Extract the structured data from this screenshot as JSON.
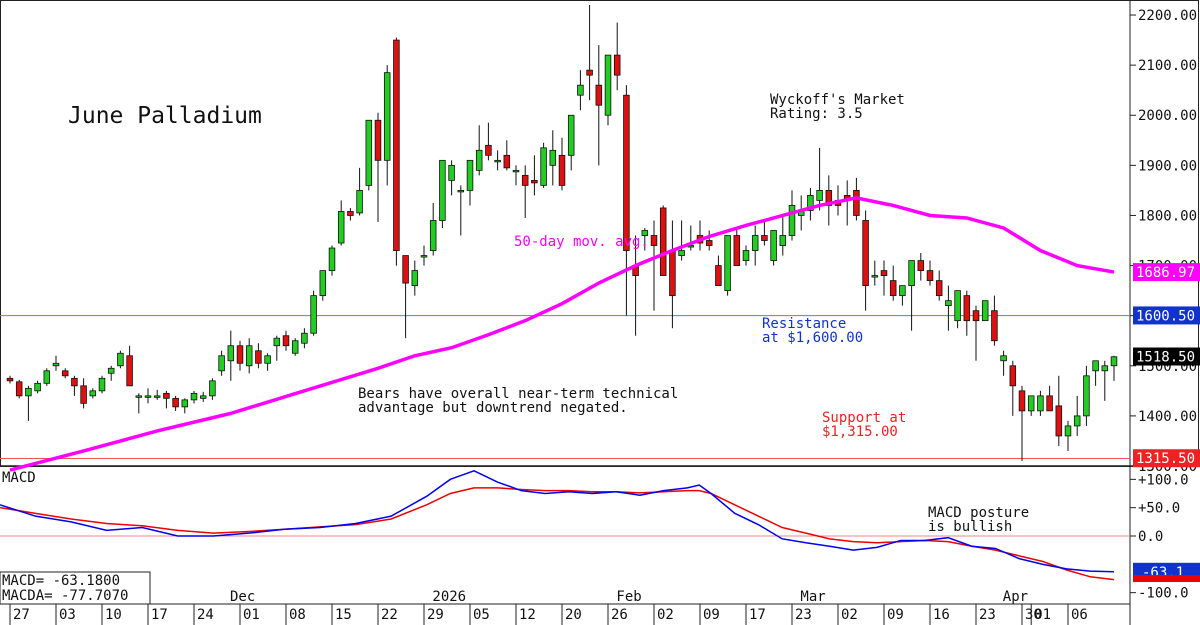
{
  "chart_data": {
    "type": "candlestick",
    "title": "June Palladium",
    "rating": "Wyckoff's Market\nRating: 3.5",
    "colors": {
      "up": "#22cc22",
      "down": "#dd1111",
      "ma": "#ff00ff",
      "macd": "#0000ee",
      "signal": "#ee0000",
      "resistance": "#6677dd",
      "support": "#ee5555"
    },
    "price_axis": {
      "ylim": [
        1300,
        2230
      ],
      "ticks": [
        1300,
        1400,
        1500,
        1600,
        1700,
        1800,
        1900,
        2000,
        2100,
        2200
      ],
      "tick_labels": [
        "1300.00",
        "1400.00",
        "1500.00",
        "1600.00",
        "1700.00",
        "1800.00",
        "1900.00",
        "2000.00",
        "2100.00",
        "2200.00"
      ]
    },
    "price_labels": [
      {
        "text": "1686.97",
        "value": 1686.97,
        "bg": "#ff00ff",
        "fg": "#ffffff"
      },
      {
        "text": "1600.50",
        "value": 1600.5,
        "bg": "#1133cc",
        "fg": "#ffffff"
      },
      {
        "text": "1518.50",
        "value": 1518.5,
        "bg": "#000000",
        "fg": "#ffffff"
      },
      {
        "text": "1315.50",
        "value": 1315.5,
        "bg": "#ee2222",
        "fg": "#ffffff"
      }
    ],
    "resistance": 1600,
    "support": 1315,
    "annotations": [
      {
        "id": "ma",
        "text": "50-day mov. avg.",
        "color": "#ff00ff"
      },
      {
        "id": "resistance",
        "text": "Resistance\nat $1,600.00",
        "color": "#1133cc"
      },
      {
        "id": "support",
        "text": "Support at\n$1,315.00",
        "color": "#ee2222"
      },
      {
        "id": "bears",
        "text": "Bears have overall near-term technical\nadvantage but downtrend negated.",
        "color": "#111111"
      },
      {
        "id": "macd_posture",
        "text": "MACD posture\nis bullish",
        "color": "#111111"
      }
    ],
    "macd_axis": {
      "ylim": [
        -120,
        120
      ],
      "ticks": [
        100,
        50,
        0,
        -100
      ],
      "tick_labels": [
        "+100.0",
        "+50.0",
        "0.0",
        "-100.0"
      ]
    },
    "macd_title": "MACD",
    "macd_readout": [
      "MACD=   -63.1800",
      "MACDA=  -77.7070"
    ],
    "macd_value_label": {
      "text": "-63.1",
      "value": -63.18,
      "bg": "#1133cc",
      "fg": "#ffffff"
    },
    "macd_signal_value": -77.707,
    "x_labels": [
      "27",
      "03",
      "10",
      "17",
      "24",
      "01",
      "08",
      "15",
      "22",
      "29",
      "05",
      "12",
      "20",
      "26",
      "02",
      "09",
      "17",
      "23",
      "02",
      "09",
      "16",
      "23",
      "30",
      "01",
      "06"
    ],
    "x_label_index": [
      0,
      5,
      10,
      15,
      20,
      25,
      30,
      35,
      40,
      45,
      50,
      55,
      60,
      65,
      70,
      75,
      80,
      85,
      90,
      95,
      100,
      105,
      110,
      111,
      115
    ],
    "month_labels": [
      {
        "text": "Dec",
        "index": 25
      },
      {
        "text": "2026",
        "index": 47
      },
      {
        "text": "Feb",
        "index": 67
      },
      {
        "text": "Mar",
        "index": 87
      },
      {
        "text": "Apr",
        "index": 109
      }
    ],
    "bars": [
      [
        1475,
        1480,
        1465,
        1470
      ],
      [
        1468,
        1472,
        1435,
        1440
      ],
      [
        1440,
        1460,
        1390,
        1455
      ],
      [
        1450,
        1470,
        1445,
        1465
      ],
      [
        1465,
        1495,
        1460,
        1490
      ],
      [
        1500,
        1520,
        1490,
        1505
      ],
      [
        1490,
        1495,
        1475,
        1480
      ],
      [
        1475,
        1480,
        1440,
        1460
      ],
      [
        1460,
        1475,
        1415,
        1425
      ],
      [
        1440,
        1455,
        1435,
        1450
      ],
      [
        1450,
        1480,
        1445,
        1475
      ],
      [
        1485,
        1500,
        1470,
        1495
      ],
      [
        1500,
        1530,
        1495,
        1525
      ],
      [
        1520,
        1540,
        1460,
        1460
      ],
      [
        1440,
        1445,
        1405,
        1440
      ],
      [
        1440,
        1455,
        1425,
        1440
      ],
      [
        1440,
        1452,
        1432,
        1440
      ],
      [
        1445,
        1450,
        1415,
        1435
      ],
      [
        1435,
        1440,
        1410,
        1418
      ],
      [
        1418,
        1435,
        1405,
        1432
      ],
      [
        1432,
        1450,
        1425,
        1445
      ],
      [
        1435,
        1448,
        1428,
        1440
      ],
      [
        1440,
        1475,
        1432,
        1470
      ],
      [
        1490,
        1530,
        1480,
        1520
      ],
      [
        1510,
        1570,
        1470,
        1540
      ],
      [
        1540,
        1550,
        1490,
        1505
      ],
      [
        1500,
        1555,
        1485,
        1540
      ],
      [
        1530,
        1545,
        1495,
        1505
      ],
      [
        1505,
        1525,
        1490,
        1520
      ],
      [
        1540,
        1560,
        1510,
        1555
      ],
      [
        1560,
        1570,
        1530,
        1540
      ],
      [
        1525,
        1555,
        1520,
        1550
      ],
      [
        1545,
        1575,
        1535,
        1565
      ],
      [
        1565,
        1650,
        1560,
        1640
      ],
      [
        1640,
        1690,
        1630,
        1690
      ],
      [
        1690,
        1740,
        1680,
        1735
      ],
      [
        1745,
        1830,
        1740,
        1808
      ],
      [
        1808,
        1815,
        1790,
        1800
      ],
      [
        1805,
        1895,
        1800,
        1850
      ],
      [
        1860,
        1955,
        1850,
        1990
      ],
      [
        1990,
        2005,
        1787,
        1910
      ],
      [
        1910,
        2100,
        1860,
        2085
      ],
      [
        2150,
        2155,
        1700,
        1730
      ],
      [
        1720,
        1710,
        1555,
        1665
      ],
      [
        1660,
        1710,
        1640,
        1690
      ],
      [
        1720,
        1740,
        1700,
        1720
      ],
      [
        1730,
        1825,
        1720,
        1790
      ],
      [
        1790,
        1870,
        1775,
        1910
      ],
      [
        1870,
        1910,
        1840,
        1900
      ],
      [
        1850,
        1860,
        1760,
        1850
      ],
      [
        1850,
        1900,
        1820,
        1910
      ],
      [
        1890,
        1980,
        1880,
        1930
      ],
      [
        1940,
        1985,
        1910,
        1920
      ],
      [
        1910,
        1930,
        1890,
        1910
      ],
      [
        1920,
        1950,
        1890,
        1895
      ],
      [
        1890,
        1900,
        1860,
        1890
      ],
      [
        1880,
        1900,
        1795,
        1860
      ],
      [
        1870,
        1920,
        1840,
        1865
      ],
      [
        1860,
        1945,
        1855,
        1935
      ],
      [
        1900,
        1970,
        1860,
        1930
      ],
      [
        1920,
        1955,
        1850,
        1860
      ],
      [
        1920,
        2000,
        1890,
        2000
      ],
      [
        2040,
        2090,
        2010,
        2060
      ],
      [
        2090,
        2220,
        2030,
        2080
      ],
      [
        2060,
        2140,
        1900,
        2020
      ],
      [
        2000,
        2110,
        1980,
        2120
      ],
      [
        2120,
        2185,
        2050,
        2080
      ],
      [
        2040,
        2060,
        1600,
        1730
      ],
      [
        1700,
        1760,
        1560,
        1680
      ],
      [
        1760,
        1775,
        1730,
        1770
      ],
      [
        1760,
        1790,
        1610,
        1740
      ],
      [
        1815,
        1820,
        1710,
        1680
      ],
      [
        1730,
        1790,
        1575,
        1640
      ],
      [
        1720,
        1790,
        1710,
        1730
      ],
      [
        1740,
        1780,
        1730,
        1740
      ],
      [
        1760,
        1790,
        1730,
        1745
      ],
      [
        1750,
        1770,
        1730,
        1740
      ],
      [
        1700,
        1720,
        1660,
        1660
      ],
      [
        1650,
        1740,
        1640,
        1760
      ],
      [
        1760,
        1775,
        1720,
        1700
      ],
      [
        1710,
        1740,
        1700,
        1730
      ],
      [
        1730,
        1780,
        1700,
        1760
      ],
      [
        1760,
        1790,
        1740,
        1750
      ],
      [
        1710,
        1760,
        1700,
        1770
      ],
      [
        1740,
        1800,
        1720,
        1760
      ],
      [
        1760,
        1850,
        1750,
        1820
      ],
      [
        1800,
        1840,
        1770,
        1810
      ],
      [
        1810,
        1855,
        1790,
        1840
      ],
      [
        1830,
        1935,
        1810,
        1850
      ],
      [
        1850,
        1880,
        1780,
        1820
      ],
      [
        1830,
        1860,
        1800,
        1820
      ],
      [
        1840,
        1870,
        1780,
        1830
      ],
      [
        1850,
        1875,
        1790,
        1800
      ],
      [
        1790,
        1810,
        1610,
        1660
      ],
      [
        1680,
        1710,
        1660,
        1680
      ],
      [
        1690,
        1710,
        1640,
        1680
      ],
      [
        1670,
        1700,
        1630,
        1640
      ],
      [
        1640,
        1660,
        1620,
        1660
      ],
      [
        1660,
        1700,
        1570,
        1710
      ],
      [
        1710,
        1725,
        1670,
        1690
      ],
      [
        1690,
        1710,
        1660,
        1670
      ],
      [
        1670,
        1690,
        1630,
        1640
      ],
      [
        1620,
        1660,
        1570,
        1630
      ],
      [
        1590,
        1640,
        1575,
        1650
      ],
      [
        1640,
        1650,
        1560,
        1590
      ],
      [
        1610,
        1620,
        1510,
        1590
      ],
      [
        1590,
        1610,
        1600,
        1630
      ],
      [
        1610,
        1640,
        1540,
        1550
      ],
      [
        1510,
        1530,
        1480,
        1520
      ],
      [
        1500,
        1510,
        1400,
        1460
      ],
      [
        1450,
        1460,
        1310,
        1410
      ],
      [
        1410,
        1440,
        1400,
        1440
      ],
      [
        1410,
        1450,
        1400,
        1440
      ],
      [
        1440,
        1460,
        1410,
        1410
      ],
      [
        1420,
        1480,
        1340,
        1360
      ],
      [
        1360,
        1390,
        1330,
        1380
      ],
      [
        1380,
        1440,
        1360,
        1400
      ],
      [
        1400,
        1500,
        1380,
        1480
      ],
      [
        1490,
        1510,
        1460,
        1510
      ],
      [
        1490,
        1510,
        1430,
        1500
      ],
      [
        1500,
        1520,
        1470,
        1518
      ]
    ],
    "ma": [
      [
        0,
        1292
      ],
      [
        8,
        1330
      ],
      [
        16,
        1370
      ],
      [
        24,
        1405
      ],
      [
        32,
        1450
      ],
      [
        40,
        1495
      ],
      [
        44,
        1520
      ],
      [
        48,
        1536
      ],
      [
        52,
        1562
      ],
      [
        56,
        1590
      ],
      [
        60,
        1624
      ],
      [
        64,
        1665
      ],
      [
        68,
        1700
      ],
      [
        72,
        1730
      ],
      [
        76,
        1758
      ],
      [
        80,
        1780
      ],
      [
        84,
        1800
      ],
      [
        88,
        1820
      ],
      [
        92,
        1835
      ],
      [
        96,
        1820
      ],
      [
        100,
        1800
      ],
      [
        104,
        1795
      ],
      [
        108,
        1775
      ],
      [
        112,
        1730
      ],
      [
        116,
        1700
      ],
      [
        120,
        1687
      ]
    ],
    "macd_line": [
      [
        0,
        55
      ],
      [
        6,
        35
      ],
      [
        12,
        25
      ],
      [
        18,
        10
      ],
      [
        24,
        15
      ],
      [
        30,
        0
      ],
      [
        36,
        0
      ],
      [
        42,
        5
      ],
      [
        48,
        12
      ],
      [
        54,
        15
      ],
      [
        60,
        22
      ],
      [
        66,
        35
      ],
      [
        72,
        70
      ],
      [
        76,
        100
      ],
      [
        80,
        115
      ],
      [
        84,
        95
      ],
      [
        88,
        80
      ],
      [
        92,
        75
      ],
      [
        96,
        78
      ],
      [
        100,
        75
      ],
      [
        104,
        78
      ],
      [
        108,
        72
      ],
      [
        112,
        80
      ],
      [
        116,
        85
      ],
      [
        118,
        90
      ],
      [
        120,
        75
      ],
      [
        124,
        40
      ],
      [
        128,
        20
      ],
      [
        132,
        -5
      ],
      [
        136,
        -12
      ],
      [
        140,
        -18
      ],
      [
        144,
        -25
      ],
      [
        148,
        -20
      ],
      [
        152,
        -8
      ],
      [
        156,
        -8
      ],
      [
        160,
        -3
      ],
      [
        164,
        -18
      ],
      [
        168,
        -22
      ],
      [
        172,
        -40
      ],
      [
        176,
        -50
      ],
      [
        180,
        -58
      ],
      [
        184,
        -62
      ],
      [
        188,
        -63
      ]
    ],
    "macd_signal": [
      [
        0,
        50
      ],
      [
        6,
        40
      ],
      [
        12,
        30
      ],
      [
        18,
        22
      ],
      [
        24,
        18
      ],
      [
        30,
        10
      ],
      [
        36,
        5
      ],
      [
        42,
        8
      ],
      [
        48,
        12
      ],
      [
        54,
        16
      ],
      [
        60,
        20
      ],
      [
        66,
        30
      ],
      [
        72,
        55
      ],
      [
        76,
        75
      ],
      [
        80,
        85
      ],
      [
        84,
        85
      ],
      [
        88,
        82
      ],
      [
        92,
        80
      ],
      [
        96,
        80
      ],
      [
        100,
        78
      ],
      [
        104,
        78
      ],
      [
        108,
        76
      ],
      [
        112,
        78
      ],
      [
        116,
        80
      ],
      [
        118,
        80
      ],
      [
        120,
        75
      ],
      [
        124,
        55
      ],
      [
        128,
        35
      ],
      [
        132,
        15
      ],
      [
        136,
        5
      ],
      [
        140,
        -5
      ],
      [
        144,
        -10
      ],
      [
        148,
        -12
      ],
      [
        152,
        -10
      ],
      [
        156,
        -8
      ],
      [
        160,
        -10
      ],
      [
        164,
        -18
      ],
      [
        168,
        -25
      ],
      [
        172,
        -35
      ],
      [
        176,
        -45
      ],
      [
        180,
        -60
      ],
      [
        184,
        -72
      ],
      [
        188,
        -77
      ]
    ]
  }
}
